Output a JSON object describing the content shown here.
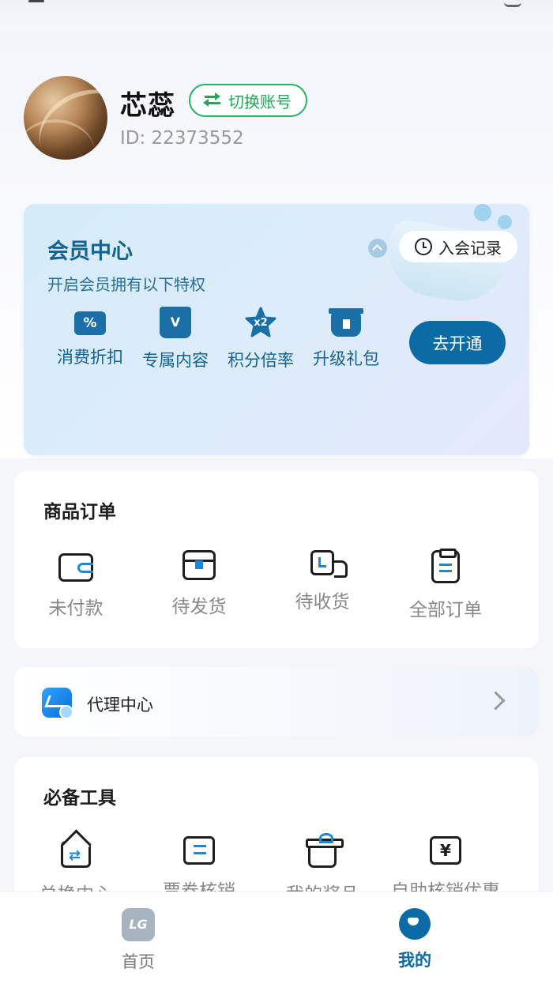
{
  "profile": {
    "name": "芯蕊",
    "id_text": "ID: 22373552",
    "switch_label": "切换账号"
  },
  "vip": {
    "title": "会员中心",
    "subtitle": "开启会员拥有以下特权",
    "record_label": "入会记录",
    "open_label": "去开通",
    "perks": [
      {
        "label": "消费折扣",
        "icon": "discount-ticket-icon",
        "glyph": "%"
      },
      {
        "label": "专属内容",
        "icon": "exclusive-content-icon",
        "glyph": "V"
      },
      {
        "label": "积分倍率",
        "icon": "points-multiplier-icon",
        "glyph": "x2"
      },
      {
        "label": "升级礼包",
        "icon": "gift-pack-icon",
        "glyph": ""
      }
    ]
  },
  "orders": {
    "title": "商品订单",
    "items": [
      {
        "label": "未付款",
        "icon": "wallet-icon"
      },
      {
        "label": "待发货",
        "icon": "package-icon"
      },
      {
        "label": "待收货",
        "icon": "truck-icon"
      },
      {
        "label": "全部订单",
        "icon": "clipboard-icon"
      }
    ]
  },
  "agent": {
    "label": "代理中心",
    "icon": "agent-chart-icon"
  },
  "tools": {
    "title": "必备工具",
    "items": [
      {
        "label": "兑换中心",
        "icon": "exchange-icon"
      },
      {
        "label": "票券核销",
        "icon": "ticket-icon"
      },
      {
        "label": "我的奖品",
        "icon": "gift-icon"
      },
      {
        "label": "自助核销优惠",
        "icon": "coupon-yen-icon"
      }
    ]
  },
  "tabbar": {
    "home": {
      "label": "首页",
      "glyph": "LG"
    },
    "mine": {
      "label": "我的"
    }
  },
  "colors": {
    "accent": "#0c6aa5",
    "switch_green": "#1fa85a",
    "vip_text": "#13628f",
    "icon_blue": "#1e88d8"
  }
}
